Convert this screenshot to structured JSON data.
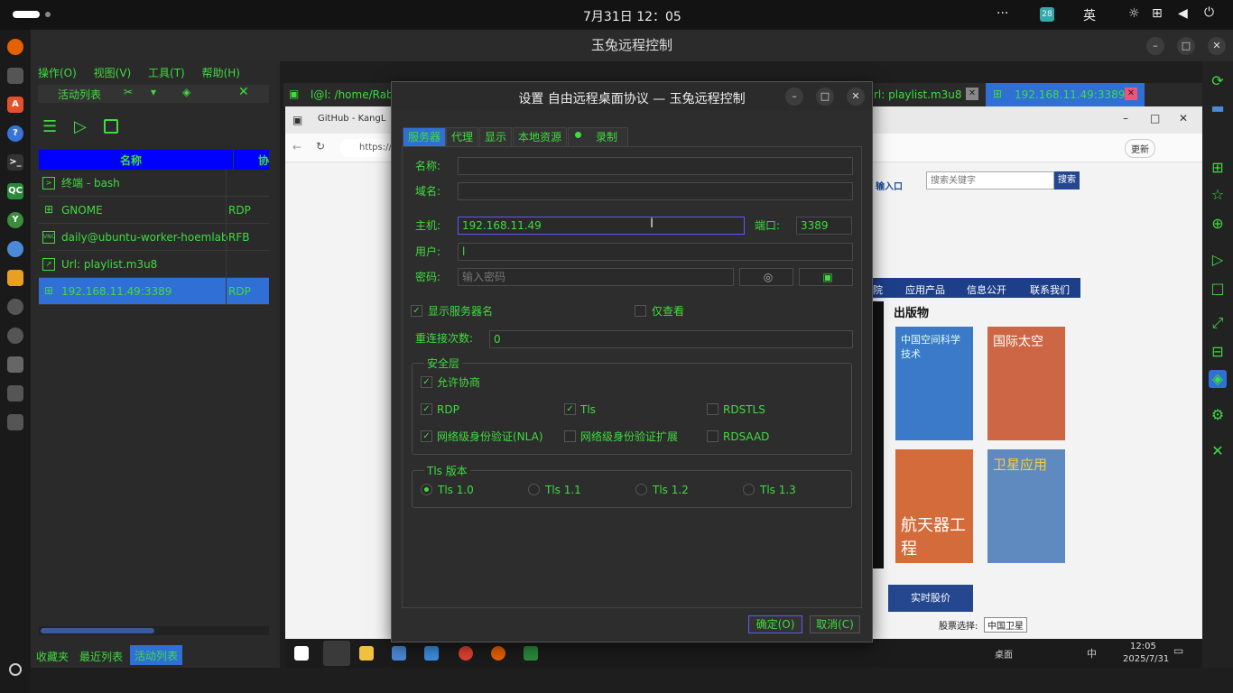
{
  "topbar": {
    "date": "7月31日",
    "time": "12：05",
    "dots": "···",
    "badge": "28",
    "ime": "英"
  },
  "app": {
    "title": "玉兔远程控制"
  },
  "left": {
    "menu": [
      "操作(O)",
      "视图(V)",
      "工具(T)",
      "帮助(H)"
    ],
    "tabs_label": "活动列表",
    "col_name": "名称",
    "col_proto": "协",
    "rows": [
      {
        "name": "终端 - bash",
        "proto": ""
      },
      {
        "name": "GNOME",
        "proto": "RDP"
      },
      {
        "name": "daily@ubuntu-worker-hoemlab",
        "proto": "RFB"
      },
      {
        "name": "Url: playlist.m3u8",
        "proto": ""
      },
      {
        "name": "192.168.11.49:3389",
        "proto": "RDP"
      }
    ],
    "bottom_tabs": [
      "收藏夹",
      "最近列表",
      "活动列表"
    ]
  },
  "session_tabs": {
    "tab1": "l@l: /home/Rab",
    "tab2": "rl: playlist.m3u8",
    "tab3": "192.168.11.49:3389"
  },
  "browser": {
    "tab": "GitHub - KangL",
    "url": "https://",
    "search_ph": "搜索关键字",
    "search_btn": "搜索",
    "login": "输入口",
    "nav": [
      "院",
      "应用产品",
      "信息公开",
      "联系我们"
    ],
    "pub_title": "出版物",
    "covers": [
      "中国空间科学技术",
      "国际太空",
      "航天器工程",
      "卫星应用"
    ],
    "stock_btn": "实时股价",
    "stock_label": "股票选择:",
    "stock_sel": "中国卫星",
    "refresh": "更新"
  },
  "dialog": {
    "title": "设置 自由远程桌面协议 — 玉兔远程控制",
    "tabs": [
      "服务器",
      "代理",
      "显示",
      "本地资源",
      "录制"
    ],
    "name_label": "名称:",
    "domain_label": "域名:",
    "host_label": "主机:",
    "host_value": "192.168.11.49",
    "port_label": "端口:",
    "port_value": "3389",
    "user_label": "用户:",
    "user_value": "l",
    "pass_label": "密码:",
    "pass_placeholder": "输入密码",
    "show_server": "显示服务器名",
    "view_only": "仅查看",
    "reconnect_label": "重连接次数:",
    "reconnect_value": "0",
    "security_title": "安全层",
    "allow_negotiate": "允许协商",
    "rdp": "RDP",
    "tls": "Tls",
    "rdstls": "RDSTLS",
    "nla": "网络级身份验证(NLA)",
    "nla_ext": "网络级身份验证扩展",
    "rdsaad": "RDSAAD",
    "tls_title": "Tls 版本",
    "tls_versions": [
      "Tls 1.0",
      "Tls 1.1",
      "Tls 1.2",
      "Tls 1.3"
    ],
    "ok": "确定(O)",
    "cancel": "取消(C)"
  },
  "taskbar": {
    "time": "12:05",
    "date": "2025/7/31",
    "desk": "桌面",
    "ime": "中"
  },
  "colors": {
    "accent": "#3fdc3f",
    "header": "#0000ff",
    "selected": "#2f6fd6"
  }
}
